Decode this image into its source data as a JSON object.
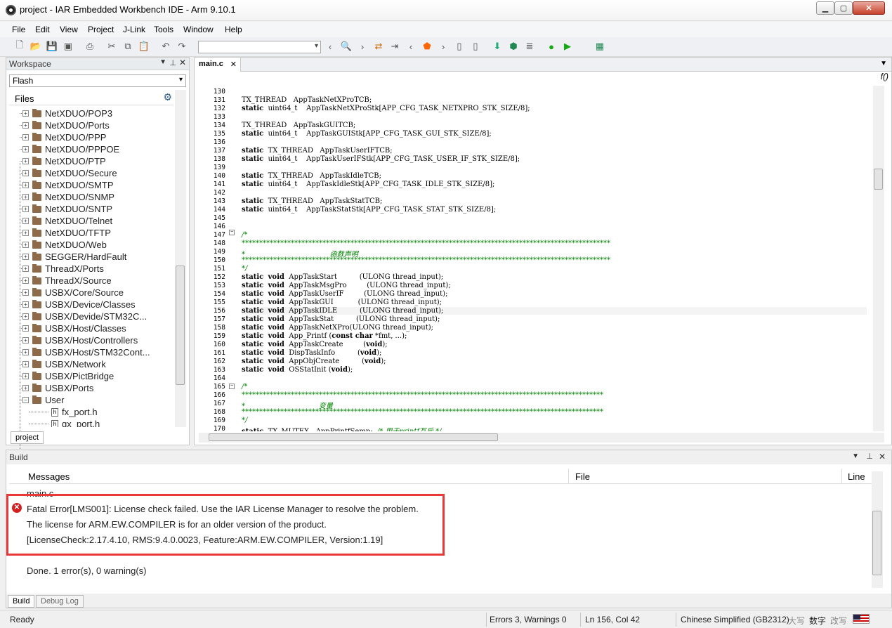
{
  "window": {
    "title": "project - IAR Embedded Workbench IDE - Arm 9.10.1",
    "min": "▁",
    "max": "▢",
    "close": "✕"
  },
  "menu": [
    "File",
    "Edit",
    "View",
    "Project",
    "J-Link",
    "Tools",
    "Window",
    "Help"
  ],
  "workspace": {
    "title": "Workspace",
    "config": "Flash",
    "files_header": "Files",
    "tree": [
      "NetXDUO/POP3",
      "NetXDUO/Ports",
      "NetXDUO/PPP",
      "NetXDUO/PPPOE",
      "NetXDUO/PTP",
      "NetXDUO/Secure",
      "NetXDUO/SMTP",
      "NetXDUO/SNMP",
      "NetXDUO/SNTP",
      "NetXDUO/Telnet",
      "NetXDUO/TFTP",
      "NetXDUO/Web",
      "SEGGER/HardFault",
      "ThreadX/Ports",
      "ThreadX/Source",
      "USBX/Core/Source",
      "USBX/Device/Classes",
      "USBX/Devide/STM32C...",
      "USBX/Host/Classes",
      "USBX/Host/Controllers",
      "USBX/Host/STM32Cont...",
      "USBX/Network",
      "USBX/PictBridge",
      "USBX/Ports",
      "User"
    ],
    "user_files": [
      "fx_port.h",
      "gx_port.h"
    ],
    "tab": "project"
  },
  "editor": {
    "tab": "main.c",
    "lines": [
      {
        "n": "130",
        "t": ""
      },
      {
        "n": "131",
        "t": "TX_THREAD   AppTaskNetXProTCB;"
      },
      {
        "n": "132",
        "t": "static  uint64_t    AppTaskNetXProStk[APP_CFG_TASK_NETXPRO_STK_SIZE/8];"
      },
      {
        "n": "133",
        "t": ""
      },
      {
        "n": "134",
        "t": "TX_THREAD   AppTaskGUITCB;"
      },
      {
        "n": "135",
        "t": "static  uint64_t    AppTaskGUIStk[APP_CFG_TASK_GUI_STK_SIZE/8];"
      },
      {
        "n": "136",
        "t": ""
      },
      {
        "n": "137",
        "t": "static  TX_THREAD   AppTaskUserIFTCB;"
      },
      {
        "n": "138",
        "t": "static  uint64_t    AppTaskUserIFStk[APP_CFG_TASK_USER_IF_STK_SIZE/8];"
      },
      {
        "n": "139",
        "t": ""
      },
      {
        "n": "140",
        "t": "static  TX_THREAD   AppTaskIdleTCB;"
      },
      {
        "n": "141",
        "t": "static  uint64_t    AppTaskIdleStk[APP_CFG_TASK_IDLE_STK_SIZE/8];"
      },
      {
        "n": "142",
        "t": ""
      },
      {
        "n": "143",
        "t": "static  TX_THREAD   AppTaskStatTCB;"
      },
      {
        "n": "144",
        "t": "static  uint64_t    AppTaskStatStk[APP_CFG_TASK_STAT_STK_SIZE/8];"
      },
      {
        "n": "145",
        "t": ""
      },
      {
        "n": "146",
        "t": ""
      },
      {
        "n": "147",
        "t": "/*",
        "c": true
      },
      {
        "n": "148",
        "t": "*********************************************************************************************************",
        "c": true
      },
      {
        "n": "149",
        "t": "*                                      函数声明",
        "c": true
      },
      {
        "n": "150",
        "t": "*********************************************************************************************************",
        "c": true
      },
      {
        "n": "151",
        "t": "*/",
        "c": true
      },
      {
        "n": "152",
        "t": "static  void  AppTaskStart          (ULONG thread_input);"
      },
      {
        "n": "153",
        "t": "static  void  AppTaskMsgPro         (ULONG thread_input);"
      },
      {
        "n": "154",
        "t": "static  void  AppTaskUserIF         (ULONG thread_input);"
      },
      {
        "n": "155",
        "t": "static  void  AppTaskGUI           (ULONG thread_input);"
      },
      {
        "n": "156",
        "t": "static  void  AppTaskIDLE          (ULONG thread_input);"
      },
      {
        "n": "157",
        "t": "static  void  AppTaskStat          (ULONG thread_input);"
      },
      {
        "n": "158",
        "t": "static  void  AppTaskNetXPro(ULONG thread_input);"
      },
      {
        "n": "159",
        "t": "static  void  App_Printf (const char *fmt, ...);"
      },
      {
        "n": "160",
        "t": "static  void  AppTaskCreate         (void);"
      },
      {
        "n": "161",
        "t": "static  void  DispTaskInfo          (void);"
      },
      {
        "n": "162",
        "t": "static  void  AppObjCreate          (void);"
      },
      {
        "n": "163",
        "t": "static  void  OSStatInit (void);"
      },
      {
        "n": "164",
        "t": ""
      },
      {
        "n": "165",
        "t": "/*",
        "c": true
      },
      {
        "n": "166",
        "t": "*******************************************************************************************************",
        "c": true
      },
      {
        "n": "167",
        "t": "*                                 变量",
        "c": true
      },
      {
        "n": "168",
        "t": "*******************************************************************************************************",
        "c": true
      },
      {
        "n": "169",
        "t": "*/",
        "c": true
      },
      {
        "n": "170",
        "t": "static  TX_MUTEX   AppPrintfSemp;  /* 用于printf互斥 */"
      }
    ]
  },
  "build": {
    "title": "Build",
    "col_messages": "Messages",
    "col_file": "File",
    "col_line": "Line",
    "file": "main.c",
    "error1": "Fatal Error[LMS001]: License check failed. Use the IAR License Manager to resolve the problem.",
    "error2": "The license for ARM.EW.COMPILER is for an older version of the product.",
    "error3": "[LicenseCheck:2.17.4.10, RMS:9.4.0.0023, Feature:ARM.EW.COMPILER, Version:1.19]",
    "done": "Done. 1 error(s), 0 warning(s)",
    "tabs": [
      "Build",
      "Debug Log"
    ]
  },
  "status": {
    "ready": "Ready",
    "errors": "Errors 3, Warnings 0",
    "pos": "Ln 156, Col 42",
    "encoding": "Chinese Simplified (GB2312)",
    "caps": "大写",
    "num": "数字",
    "ovr": "改写"
  },
  "colors": {
    "highlight_box": "#e8383a",
    "keyword": "#000000",
    "comment": "#008000"
  }
}
